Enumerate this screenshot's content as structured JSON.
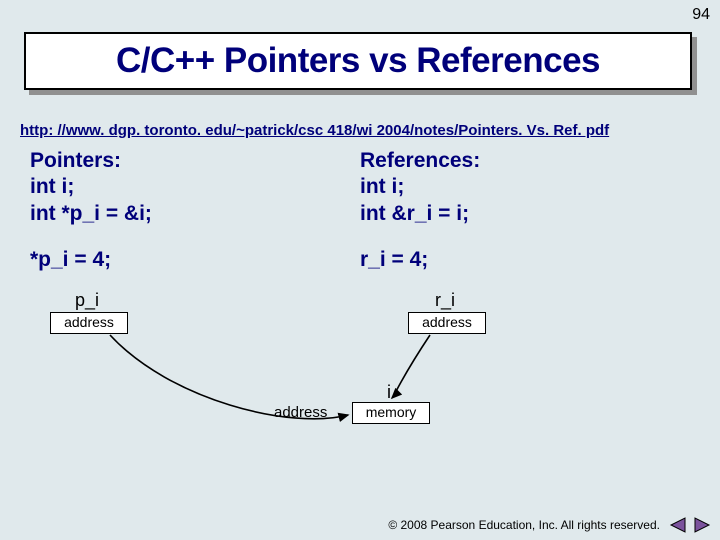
{
  "page_number": "94",
  "title": "C/C++ Pointers vs References",
  "url": "http: //www. dgp. toronto. edu/~patrick/csc 418/wi 2004/notes/Pointers. Vs. Ref. pdf",
  "pointers": {
    "heading": "Pointers:",
    "decl1": "int i;",
    "decl2": "int *p_i = &i;",
    "assign": "*p_i = 4;",
    "var_label": "p_i",
    "box_label": "address"
  },
  "references": {
    "heading": "References:",
    "decl1": "int i;",
    "decl2": "int &r_i = i;",
    "assign": "r_i = 4;",
    "var_label": "r_i",
    "box_label": "address"
  },
  "target": {
    "i_label": "i",
    "addr_label": "address",
    "mem_label": "memory"
  },
  "copyright": "© 2008 Pearson Education, Inc.  All rights reserved.",
  "nav": {
    "prev": "prev-slide",
    "next": "next-slide"
  },
  "colors": {
    "accent": "#00007a",
    "nav_triangle": "#7a529c"
  }
}
